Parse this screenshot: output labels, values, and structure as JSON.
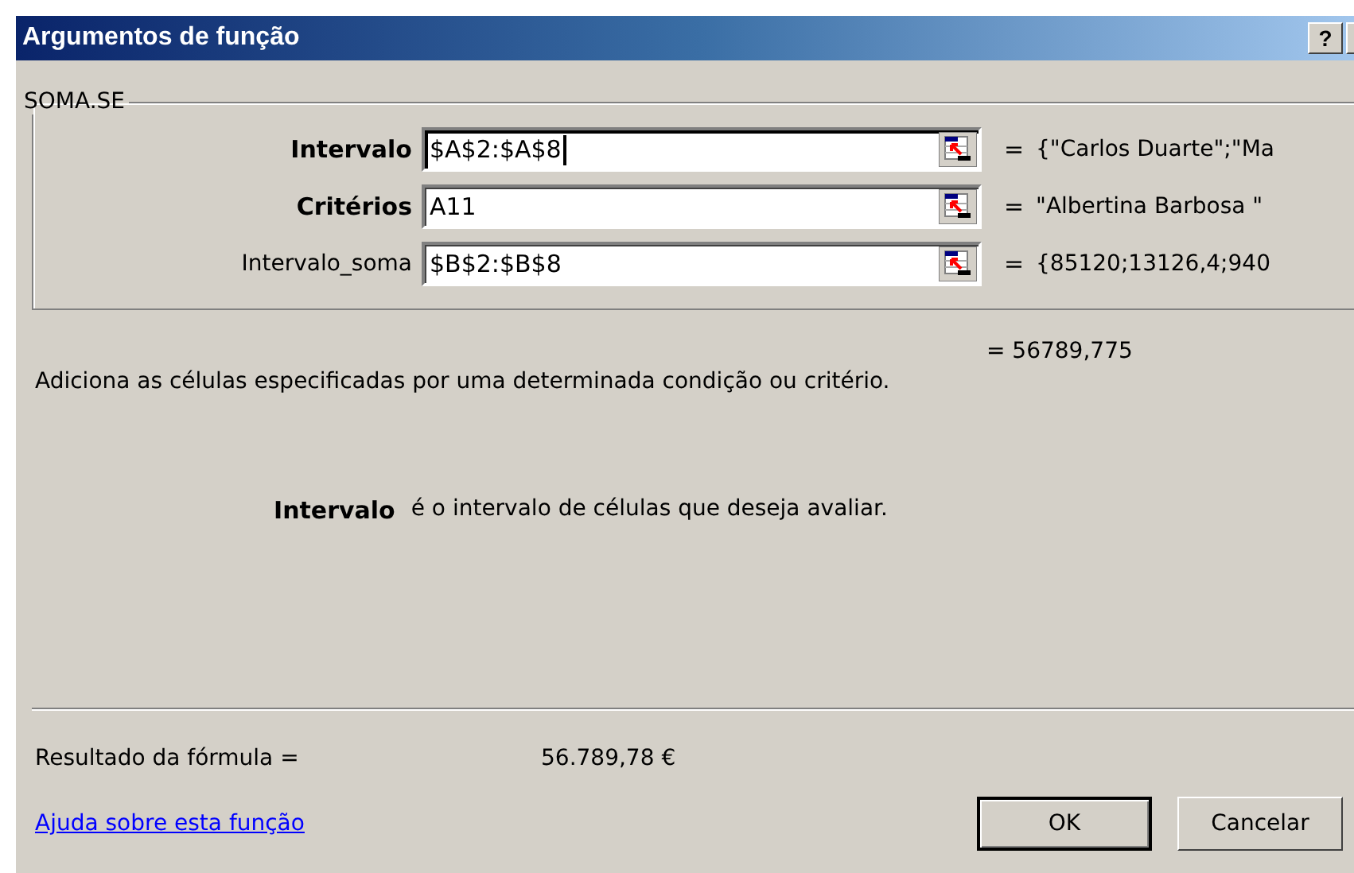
{
  "window": {
    "title": "Argumentos de função",
    "help_button": "?"
  },
  "function_group": {
    "name": "SOMA.SE",
    "arguments": [
      {
        "label": "Intervalo",
        "required": true,
        "focused": true,
        "value": "$A$2:$A$8",
        "equals": "=",
        "result": "{\"Carlos Duarte\";\"Ma"
      },
      {
        "label": "Critérios",
        "required": true,
        "focused": false,
        "value": "A11",
        "equals": "=",
        "result": "\"Albertina Barbosa \""
      },
      {
        "label": "Intervalo_soma",
        "required": false,
        "focused": false,
        "value": "$B$2:$B$8",
        "equals": "=",
        "result": "{85120;13126,4;940"
      }
    ]
  },
  "function_result": "= 56789,775",
  "description": "Adiciona as células especificadas por uma determinada condição ou critério.",
  "argument_help": {
    "name": "Intervalo",
    "text": "é o intervalo de células que deseja avaliar."
  },
  "formula_result": {
    "label": "Resultado da fórmula =",
    "value": "56.789,78 €"
  },
  "help_link": "Ajuda sobre esta função",
  "buttons": [
    {
      "label": "OK",
      "default": true
    },
    {
      "label": "Cancelar",
      "default": false
    }
  ]
}
